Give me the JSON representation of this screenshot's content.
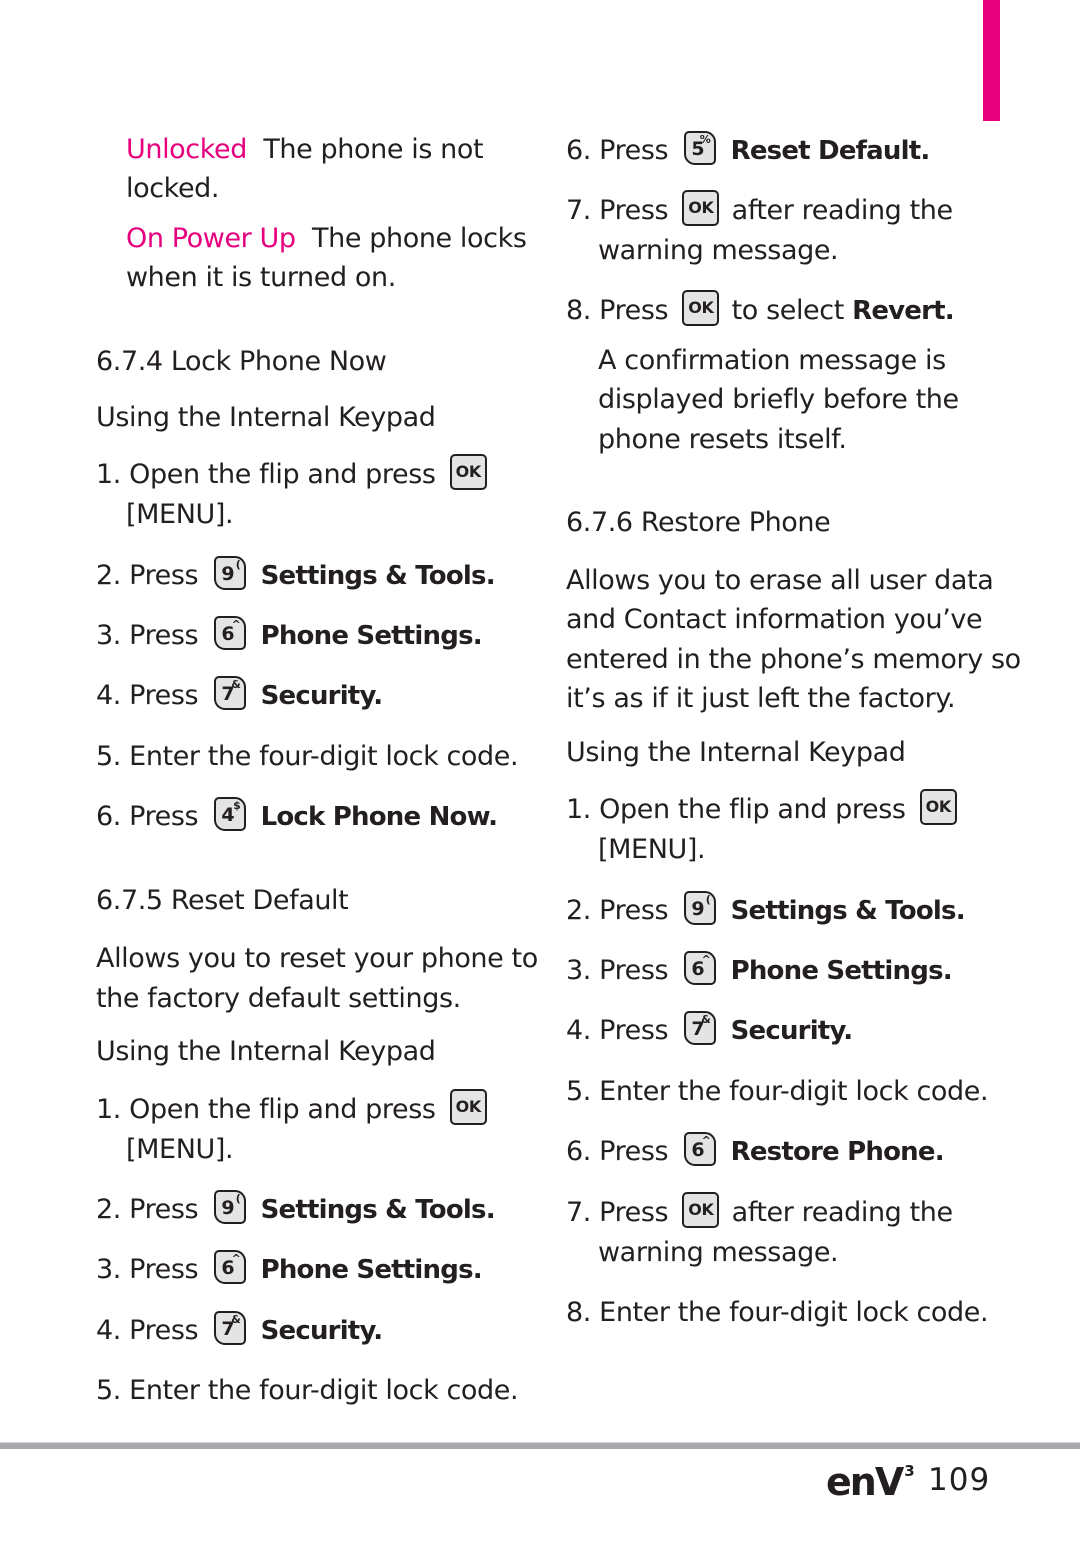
{
  "colors": {
    "accent": "#e6007e",
    "text": "#231f20",
    "key_fill": "#e4e4e4",
    "rule": "#a7a9ac"
  },
  "left": {
    "lock_options": [
      {
        "term": "Unlocked",
        "desc_line1": "The phone is not",
        "desc_line2": "locked."
      },
      {
        "term": "On Power Up",
        "desc_line1": "The phone locks",
        "desc_line2": "when it is turned on."
      }
    ],
    "lock_now": {
      "heading": "6.7.4 Lock Phone Now",
      "subheading": "Using the Internal Keypad",
      "steps": [
        {
          "num": "1.",
          "text": "Open the flip and press",
          "key": "OK",
          "cont": "[MENU]."
        },
        {
          "num": "2.",
          "text": "Press",
          "key_num": "9",
          "key_sym": "(",
          "label": "Settings & Tools."
        },
        {
          "num": "3.",
          "text": "Press",
          "key_num": "6",
          "key_sym": "^",
          "label": "Phone Settings."
        },
        {
          "num": "4.",
          "text": "Press",
          "key_num": "7",
          "key_sym": "&",
          "label": "Security."
        },
        {
          "num": "5.",
          "text": "Enter the four-digit lock code."
        },
        {
          "num": "6.",
          "text": "Press",
          "key_num": "4",
          "key_sym": "$",
          "label": "Lock Phone Now."
        }
      ]
    },
    "reset_default": {
      "heading": "6.7.5 Reset Default",
      "desc_line1": "Allows you to reset your phone to",
      "desc_line2": "the factory default settings.",
      "subheading": "Using the Internal Keypad",
      "steps": [
        {
          "num": "1.",
          "text": "Open the flip and press",
          "key": "OK",
          "cont": "[MENU]."
        },
        {
          "num": "2.",
          "text": "Press",
          "key_num": "9",
          "key_sym": "(",
          "label": "Settings & Tools."
        },
        {
          "num": "3.",
          "text": "Press",
          "key_num": "6",
          "key_sym": "^",
          "label": "Phone Settings."
        },
        {
          "num": "4.",
          "text": "Press",
          "key_num": "7",
          "key_sym": "&",
          "label": "Security."
        },
        {
          "num": "5.",
          "text": "Enter the four-digit lock code."
        }
      ]
    }
  },
  "right": {
    "reset_default_cont": {
      "steps": [
        {
          "num": "6.",
          "text": "Press",
          "key_num": "5",
          "key_sym": "%",
          "label": "Reset Default."
        },
        {
          "num": "7.",
          "text": "Press",
          "key": "OK",
          "after": "after reading the",
          "cont": "warning message."
        },
        {
          "num": "8.",
          "text": "Press",
          "key": "OK",
          "after": "to select",
          "bold": "Revert."
        }
      ],
      "note_line1": "A confirmation message is",
      "note_line2": "displayed briefly before the",
      "note_line3": "phone resets itself."
    },
    "restore_phone": {
      "heading": "6.7.6 Restore Phone",
      "desc_line1": "Allows you to erase all user data",
      "desc_line2": "and Contact information you’ve",
      "desc_line3": "entered in the phone’s memory so",
      "desc_line4": "it’s as if it just left the factory.",
      "subheading": "Using the Internal Keypad",
      "steps": [
        {
          "num": "1.",
          "text": "Open the flip and press",
          "key": "OK",
          "cont": "[MENU]."
        },
        {
          "num": "2.",
          "text": "Press",
          "key_num": "9",
          "key_sym": "(",
          "label": "Settings & Tools."
        },
        {
          "num": "3.",
          "text": "Press",
          "key_num": "6",
          "key_sym": "^",
          "label": "Phone Settings."
        },
        {
          "num": "4.",
          "text": "Press",
          "key_num": "7",
          "key_sym": "&",
          "label": "Security."
        },
        {
          "num": "5.",
          "text": "Enter the four-digit lock code."
        },
        {
          "num": "6.",
          "text": "Press",
          "key_num": "6",
          "key_sym": "^",
          "label": "Restore Phone."
        },
        {
          "num": "7.",
          "text": "Press",
          "key": "OK",
          "after": "after reading the",
          "cont": "warning message."
        },
        {
          "num": "8.",
          "text": "Enter the four-digit lock code."
        }
      ]
    }
  },
  "footer": {
    "logo_text": "enV",
    "logo_sup": "3",
    "page_number": "109"
  }
}
